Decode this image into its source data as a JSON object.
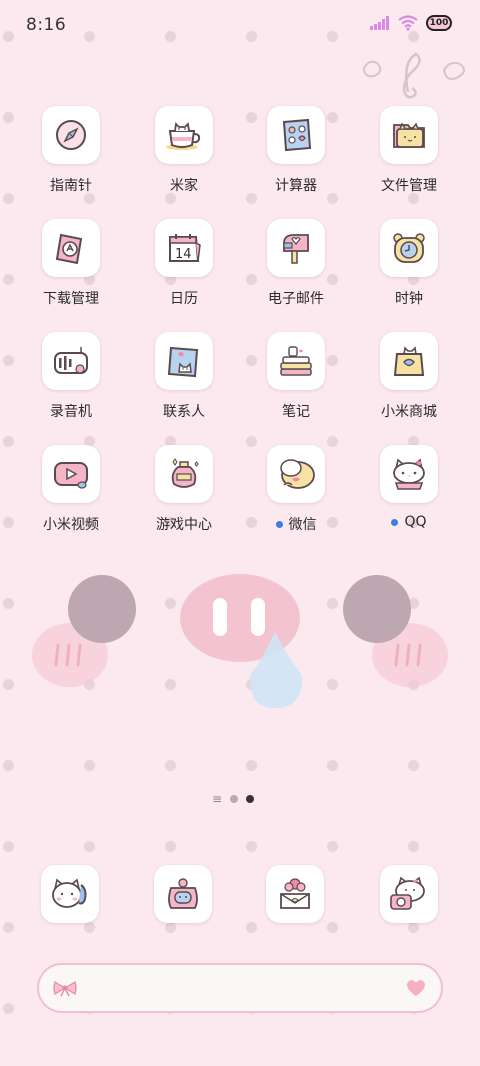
{
  "status_bar": {
    "time": "8:16",
    "battery_level": "100",
    "signal_color": "#d78be3",
    "wifi_color": "#d78be3"
  },
  "apps": [
    {
      "label": "指南针",
      "icon": "compass-icon"
    },
    {
      "label": "米家",
      "icon": "teacup-cat-icon"
    },
    {
      "label": "计算器",
      "icon": "calculator-icon"
    },
    {
      "label": "文件管理",
      "icon": "cat-folder-icon"
    },
    {
      "label": "下载管理",
      "icon": "download-icon"
    },
    {
      "label": "日历",
      "icon": "calendar-icon",
      "day": "14"
    },
    {
      "label": "电子邮件",
      "icon": "mailbox-icon"
    },
    {
      "label": "时钟",
      "icon": "alarm-clock-icon"
    },
    {
      "label": "录音机",
      "icon": "recorder-icon"
    },
    {
      "label": "联系人",
      "icon": "contacts-icon"
    },
    {
      "label": "笔记",
      "icon": "notes-books-icon"
    },
    {
      "label": "小米商城",
      "icon": "shopping-bag-icon"
    },
    {
      "label": "小米视频",
      "icon": "video-play-icon"
    },
    {
      "label": "游戏中心",
      "icon": "game-potion-icon"
    },
    {
      "label": "微信",
      "icon": "wechat-chick-icon",
      "badge": true
    },
    {
      "label": "QQ",
      "icon": "qq-kitty-icon",
      "badge": true
    }
  ],
  "dock": [
    {
      "icon": "phone-cat-icon"
    },
    {
      "icon": "browser-astronaut-icon"
    },
    {
      "icon": "message-flower-icon"
    },
    {
      "icon": "camera-cat-icon"
    }
  ],
  "page_indicator": {
    "pages": 2,
    "current": 2
  },
  "search_bar": {
    "left_icon": "bow-icon",
    "right_icon": "heart-icon"
  },
  "colors": {
    "background": "#fbe9ef",
    "badge": "#3b7de8",
    "accent_pink": "#f2bfcd"
  }
}
